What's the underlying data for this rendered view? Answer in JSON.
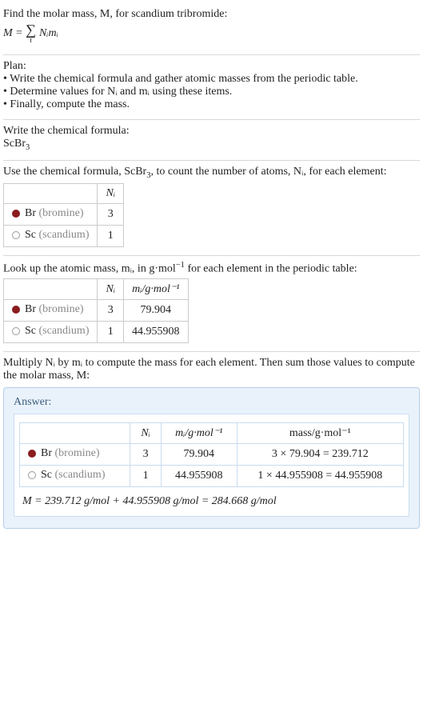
{
  "intro": {
    "line1": "Find the molar mass, M, for scandium tribromide:",
    "eq_left": "M = ",
    "sigma_under": "i",
    "eq_right": "Nᵢmᵢ"
  },
  "plan": {
    "heading": "Plan:",
    "b1": "• Write the chemical formula and gather atomic masses from the periodic table.",
    "b2": "• Determine values for Nᵢ and mᵢ using these items.",
    "b3": "• Finally, compute the mass."
  },
  "step_formula": {
    "heading": "Write the chemical formula:",
    "formula_base": "ScBr",
    "formula_sub": "3"
  },
  "step_count": {
    "heading_a": "Use the chemical formula, ScBr",
    "heading_sub": "3",
    "heading_b": ", to count the number of atoms, Nᵢ, for each element:",
    "col_ni": "Nᵢ",
    "rows": [
      {
        "sym": "Br",
        "name": "(bromine)",
        "dot": "dot-br",
        "ni": "3"
      },
      {
        "sym": "Sc",
        "name": "(scandium)",
        "dot": "dot-sc",
        "ni": "1"
      }
    ]
  },
  "step_mass": {
    "heading_a": "Look up the atomic mass, mᵢ, in g·mol",
    "heading_sup": "−1",
    "heading_b": " for each element in the periodic table:",
    "col_ni": "Nᵢ",
    "col_mi": "mᵢ/g·mol⁻¹",
    "rows": [
      {
        "sym": "Br",
        "name": "(bromine)",
        "dot": "dot-br",
        "ni": "3",
        "mi": "79.904"
      },
      {
        "sym": "Sc",
        "name": "(scandium)",
        "dot": "dot-sc",
        "ni": "1",
        "mi": "44.955908"
      }
    ]
  },
  "step_mult": {
    "heading": "Multiply Nᵢ by mᵢ to compute the mass for each element. Then sum those values to compute the molar mass, M:"
  },
  "answer": {
    "label": "Answer:",
    "col_ni": "Nᵢ",
    "col_mi": "mᵢ/g·mol⁻¹",
    "col_mass": "mass/g·mol⁻¹",
    "rows": [
      {
        "sym": "Br",
        "name": "(bromine)",
        "dot": "dot-br",
        "ni": "3",
        "mi": "79.904",
        "mass": "3 × 79.904 = 239.712"
      },
      {
        "sym": "Sc",
        "name": "(scandium)",
        "dot": "dot-sc",
        "ni": "1",
        "mi": "44.955908",
        "mass": "1 × 44.955908 = 44.955908"
      }
    ],
    "final": "M = 239.712 g/mol + 44.955908 g/mol = 284.668 g/mol"
  }
}
